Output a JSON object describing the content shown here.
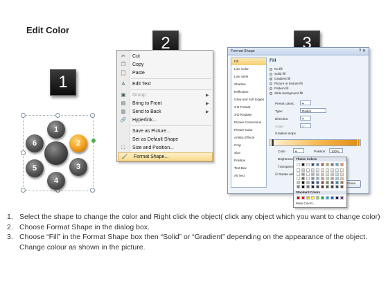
{
  "title": "Edit Color",
  "steps": [
    "1",
    "2",
    "3"
  ],
  "shape_group": {
    "balls": [
      "1",
      "2",
      "3",
      "4",
      "5",
      "6"
    ],
    "highlight_color": "#f3a321"
  },
  "context_menu": {
    "items": [
      {
        "label": "Cut",
        "icon": "scissors-icon",
        "disabled": false,
        "submenu": false
      },
      {
        "label": "Copy",
        "icon": "copy-icon",
        "disabled": false,
        "submenu": false
      },
      {
        "label": "Paste",
        "icon": "paste-icon",
        "disabled": false,
        "submenu": false
      },
      {
        "label": "Edit Text",
        "icon": "edit-text-icon",
        "disabled": false,
        "submenu": false
      },
      {
        "label": "Group",
        "icon": "group-icon",
        "disabled": true,
        "submenu": true
      },
      {
        "label": "Bring to Front",
        "icon": "bring-front-icon",
        "disabled": false,
        "submenu": true
      },
      {
        "label": "Send to Back",
        "icon": "send-back-icon",
        "disabled": false,
        "submenu": true
      },
      {
        "label": "Hyperlink...",
        "icon": "hyperlink-icon",
        "disabled": false,
        "submenu": false
      },
      {
        "label": "Save as Picture...",
        "icon": "",
        "disabled": false,
        "submenu": false
      },
      {
        "label": "Set as Default Shape",
        "icon": "",
        "disabled": false,
        "submenu": false
      },
      {
        "label": "Size and Position...",
        "icon": "size-icon",
        "disabled": false,
        "submenu": false
      },
      {
        "label": "Format Shape...",
        "icon": "format-shape-icon",
        "disabled": false,
        "submenu": false
      }
    ],
    "highlighted": "Format Shape..."
  },
  "format_dialog": {
    "title": "Format Shape",
    "close_x": "?  ✕",
    "nav": [
      "Fill",
      "Line Color",
      "Line Style",
      "Shadow",
      "Reflection",
      "Glow and Soft Edges",
      "3-D Format",
      "3-D Rotation",
      "Picture Corrections",
      "Picture Color",
      "Artistic Effects",
      "Crop",
      "Size",
      "Position",
      "Text Box",
      "Alt Text"
    ],
    "pane_heading": "Fill",
    "fill_options": [
      "No fill",
      "Solid fill",
      "Gradient fill",
      "Picture or texture fill",
      "Pattern fill",
      "Slide background fill"
    ],
    "selected_fill": "Gradient fill",
    "preset_colors_label": "Preset colors:",
    "type_label": "Type:",
    "type_value": "Radial",
    "direction_label": "Direction:",
    "angle_label": "Angle:",
    "angle_value": "0°",
    "gradient_stops_label": "Gradient stops",
    "color_label": "Color",
    "position_label": "Position:",
    "position_value": "100%",
    "brightness_label": "Brightness:",
    "transparency_label": "Transparency:",
    "rotate_label": "Rotate with shape",
    "close_button": "Close",
    "theme_colors_header": "Theme Colors",
    "standard_colors_header": "Standard Colors",
    "more_colors": "More Colors...",
    "theme_top_row": [
      "#ffffff",
      "#000000",
      "#eeece1",
      "#1f497d",
      "#4f81bd",
      "#c0504d",
      "#9bbb59",
      "#8064a2",
      "#4bacc6",
      "#f79646"
    ],
    "standard_row": [
      "#c00000",
      "#ff0000",
      "#ffc000",
      "#ffff00",
      "#92d050",
      "#00b050",
      "#00b0f0",
      "#0070c0",
      "#002060",
      "#7030a0"
    ]
  },
  "instructions": [
    {
      "num": "1.",
      "text": "Select the shape to change the color and Right click the object( click any object which you want to change color)"
    },
    {
      "num": "2.",
      "text": "Choose Format Shape in the dialog box."
    },
    {
      "num": "3.",
      "text": "Choose “Fill” in the Format Shape box then “Solid” or “Gradient” depending on the appearance of the object. Change colour as shown in the picture."
    }
  ]
}
